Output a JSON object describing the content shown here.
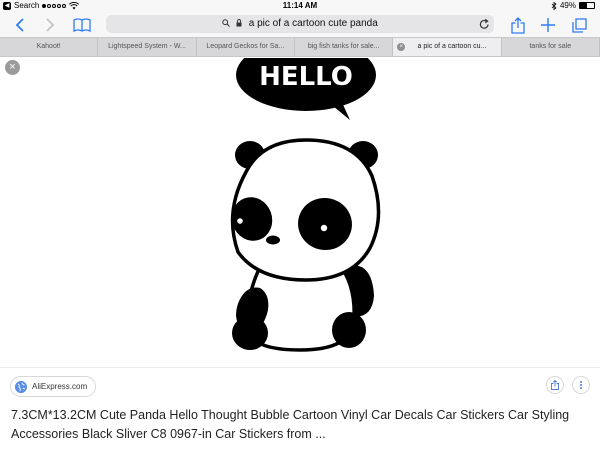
{
  "status_bar": {
    "back_app": "Search",
    "time": "11:14 AM",
    "battery": "49%",
    "battery_level": 0.49
  },
  "toolbar": {
    "address": "a pic of a cartoon cute panda"
  },
  "tabs": [
    {
      "label": "Kahoot!"
    },
    {
      "label": "Lightspeed System - W..."
    },
    {
      "label": "Leopard Geckos for Sa..."
    },
    {
      "label": "big fish tanks for sale..."
    },
    {
      "label": "a pic of a cartoon cu...",
      "active": true
    },
    {
      "label": "tanks for sale"
    }
  ],
  "content": {
    "speech_bubble_text": "HELLO",
    "source": "AliExpress.com",
    "caption": "7.3CM*13.2CM Cute Panda Hello Thought Bubble Cartoon Vinyl Car Decals Car Stickers Car Styling Accessories Black Sliver C8 0967-in Car Stickers from ..."
  },
  "colors": {
    "accent": "#2f7cf6",
    "toolbar_bg": "#f7f7f7",
    "tab_bar_bg": "#d7d7d9"
  }
}
